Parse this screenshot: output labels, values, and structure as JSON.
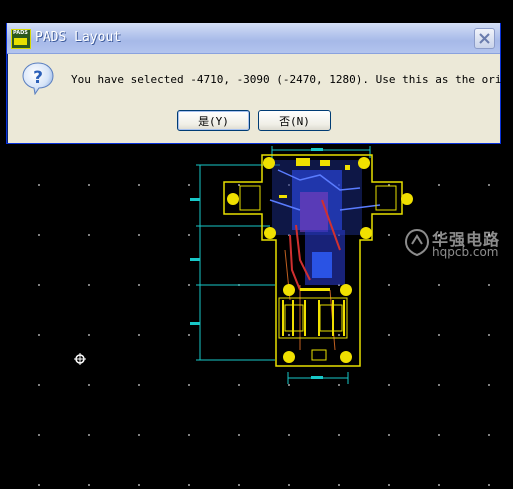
{
  "dialog": {
    "title": "PADS Layout",
    "icon_name": "pads-app-icon",
    "message": "You have selected -4710, -3090 (-2470, 1280).  Use this as the origin?",
    "buttons": {
      "yes_label": "是(Y)",
      "no_label": "否(N)"
    },
    "close_icon": "close-icon",
    "message_icon": "question-icon"
  },
  "workspace": {
    "background": "#000000",
    "origin_marker_icon": "origin-crosshair-icon",
    "colors": {
      "board_outline": "#e8e000",
      "dimension_lines": "#18c8c8",
      "traces": "#3050ff",
      "copper_red": "#d03030",
      "pads": "#f0e000"
    }
  },
  "watermark": {
    "name": "华强电路",
    "url": "hqpcb.com"
  }
}
